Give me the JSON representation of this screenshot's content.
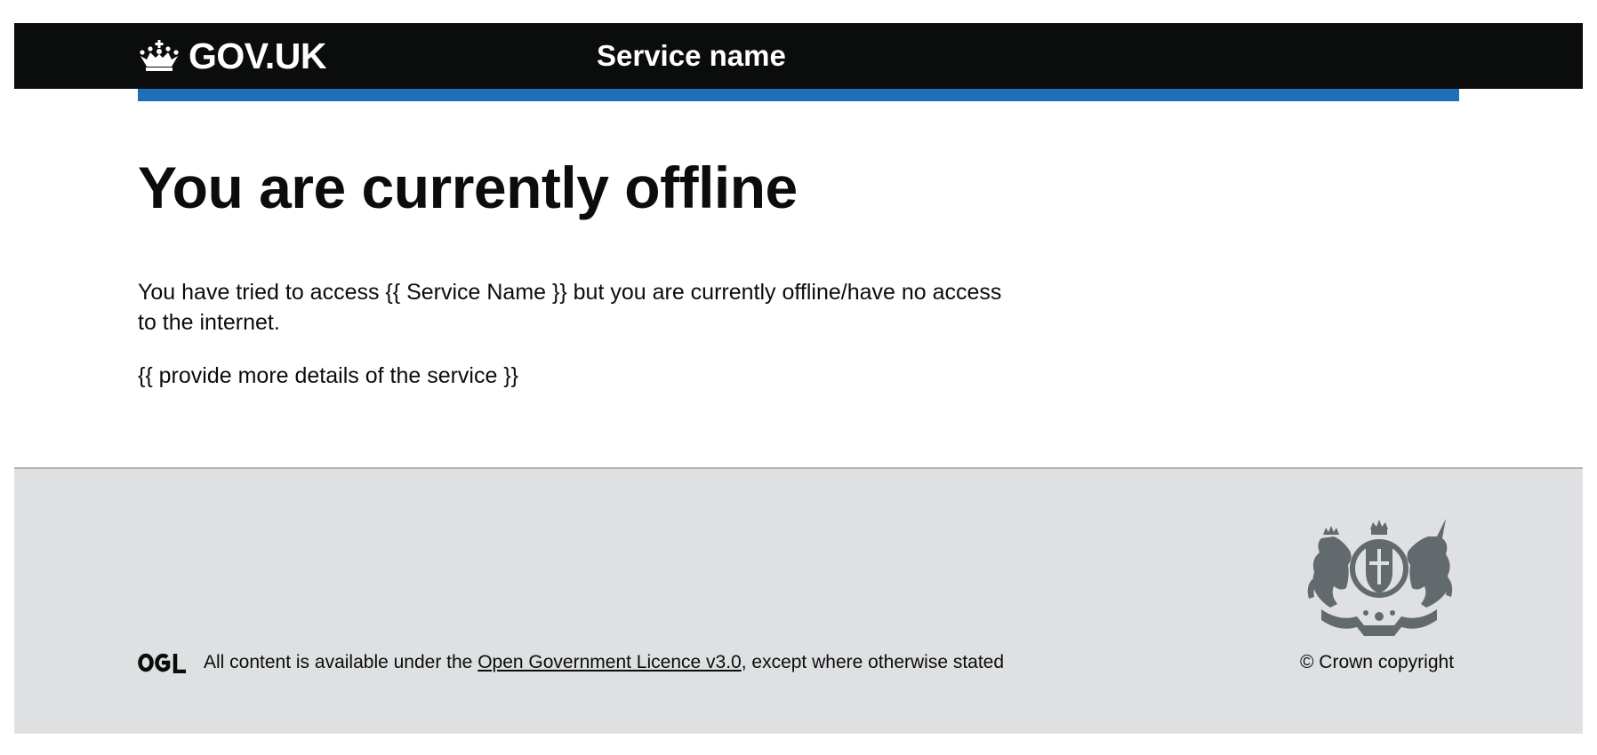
{
  "header": {
    "logo_text": "GOV.UK",
    "service_name": "Service name",
    "logo_icon": "crown-icon",
    "colors": {
      "background": "#0b0c0c",
      "accent_bar": "#1d70b8",
      "text": "#ffffff"
    }
  },
  "main": {
    "title": "You are currently offline",
    "paragraph_1": "You have tried to access {{ Service Name }} but you are currently offline/have no access to the internet.",
    "paragraph_2": "{{ provide more details of the service }}"
  },
  "footer": {
    "ogl_icon": "ogl-logo-icon",
    "licence_prefix": "All content is available under the ",
    "licence_link": "Open Government Licence v3.0",
    "licence_suffix": ", except where otherwise stated",
    "crest_icon": "royal-coat-of-arms-icon",
    "copyright": "© Crown copyright",
    "colors": {
      "background": "#dfe0e2",
      "border": "#b1b4b6",
      "crest": "#626a6e"
    }
  }
}
